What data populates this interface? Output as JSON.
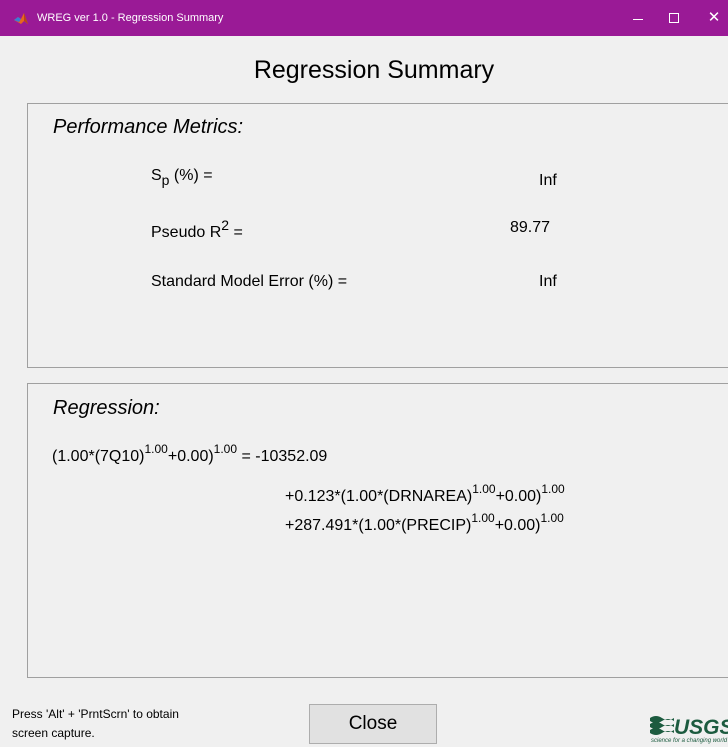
{
  "window": {
    "title": "WREG ver 1.0 - Regression Summary",
    "icon": "matlab-icon",
    "title_bar_color": "#9a1a96",
    "minimize_icon": "minimize-icon",
    "maximize_icon": "maximize-icon",
    "close_icon": "close-icon",
    "close_glyph": "✕"
  },
  "page_title": "Regression Summary",
  "metrics": {
    "section_label": "Performance Metrics:",
    "sp": {
      "base": "S",
      "subscript": "p",
      "rest": " (%) =",
      "value": "Inf"
    },
    "pseudo_r2": {
      "base": "Pseudo R",
      "superscript": "2",
      "rest": " =",
      "value": "89.77"
    },
    "sme": {
      "label": "Standard Model Error (%) =",
      "value": "Inf"
    }
  },
  "regression": {
    "section_label": "Regression:",
    "line1": {
      "a": "(1.00*(7Q10)",
      "e1": "1.00",
      "b": "+0.00)",
      "e2": "1.00",
      "c": " = -10352.09"
    },
    "line2": {
      "a": "+0.123*(1.00*(DRNAREA)",
      "e1": "1.00",
      "b": "+0.00)",
      "e2": "1.00"
    },
    "line3": {
      "a": "+287.491*(1.00*(PRECIP)",
      "e1": "1.00",
      "b": "+0.00)",
      "e2": "1.00"
    }
  },
  "footer": {
    "hint_line1": "Press 'Alt' + 'PrntScrn' to obtain",
    "hint_line2": "screen capture.",
    "close_label": "Close",
    "logo": {
      "name": "usgs-logo",
      "text": "USGS",
      "tagline": "science for a changing world"
    }
  }
}
